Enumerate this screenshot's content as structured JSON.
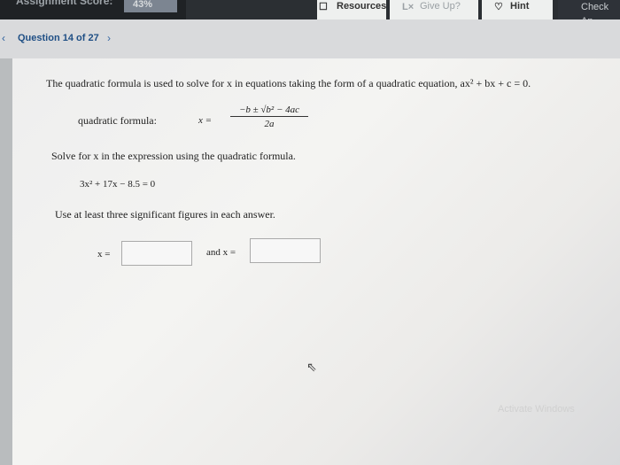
{
  "topbar": {
    "score_label": "Assignment Score:",
    "score_value": "43%",
    "resources_label": "Resources",
    "give_up_label": "Give Up?",
    "hint_label": "Hint",
    "check_label": "Check An"
  },
  "question_nav": {
    "title": "Question 14 of 27"
  },
  "problem": {
    "intro": "The quadratic formula is used to solve for x in equations taking the form of a quadratic equation, ax² + bx + c = 0.",
    "formula_label": "quadratic formula:",
    "formula_x": "x =",
    "formula_numerator": "−b ± √b² − 4ac",
    "formula_denominator": "2a",
    "solve_text": "Solve for x in the expression using the quadratic formula.",
    "expression": "3x² + 17x − 8.5 = 0",
    "instruction": "Use at least three significant figures in each answer.",
    "answer1_label": "x =",
    "answer2_label": "and x ="
  },
  "watermark": "Activate Windows",
  "colors": {
    "topbar": "#2b2f33",
    "question_link": "#1f4f85",
    "card_bg": "#efefee"
  }
}
